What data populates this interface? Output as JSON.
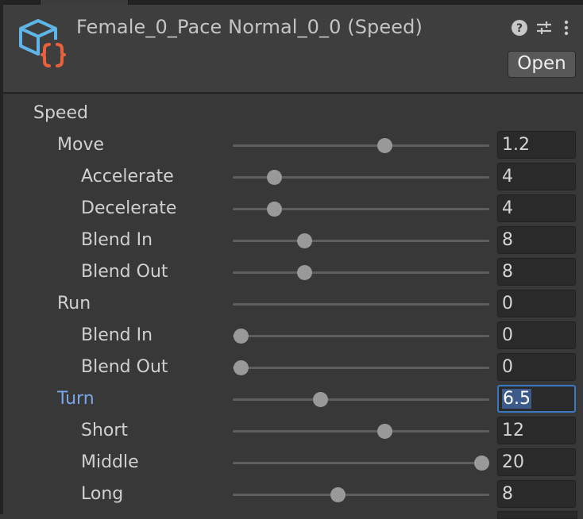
{
  "header": {
    "title": "Female_0_Pace Normal_0_0 (Speed)",
    "open_label": "Open",
    "icons": [
      "help-icon",
      "presets-icon",
      "more-menu-icon"
    ]
  },
  "colors": {
    "accent": "#7ba6e8",
    "icon_cube": "#5fb4e8",
    "icon_braces": "#e8603c"
  },
  "section": {
    "label": "Speed"
  },
  "rows": [
    {
      "label": "Move",
      "value": "1.2",
      "level": 0.59,
      "indent": 1,
      "thumb": true
    },
    {
      "label": "Accelerate",
      "value": "4",
      "level": 0.16,
      "indent": 2,
      "thumb": true
    },
    {
      "label": "Decelerate",
      "value": "4",
      "level": 0.16,
      "indent": 2,
      "thumb": true
    },
    {
      "label": "Blend In",
      "value": "8",
      "level": 0.28,
      "indent": 2,
      "thumb": true
    },
    {
      "label": "Blend Out",
      "value": "8",
      "level": 0.28,
      "indent": 2,
      "thumb": true
    },
    {
      "label": "Run",
      "value": "0",
      "level": 0,
      "indent": 1,
      "thumb": false
    },
    {
      "label": "Blend In",
      "value": "0",
      "level": 0.03,
      "indent": 2,
      "thumb": true
    },
    {
      "label": "Blend Out",
      "value": "0",
      "level": 0.03,
      "indent": 2,
      "thumb": true
    },
    {
      "label": "Turn",
      "value": "6.5",
      "level": 0.34,
      "indent": 1,
      "thumb": true,
      "active": true,
      "focused": true
    },
    {
      "label": "Short",
      "value": "12",
      "level": 0.59,
      "indent": 2,
      "thumb": true
    },
    {
      "label": "Middle",
      "value": "20",
      "level": 0.97,
      "indent": 2,
      "thumb": true
    },
    {
      "label": "Long",
      "value": "8",
      "level": 0.41,
      "indent": 2,
      "thumb": true
    }
  ]
}
